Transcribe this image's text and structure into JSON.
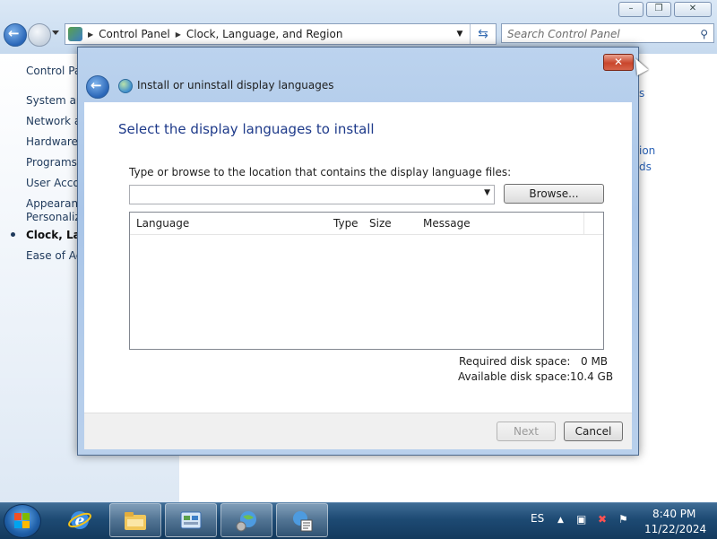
{
  "explorer": {
    "address": {
      "crumbs": [
        "Control Panel",
        "Clock, Language, and Region"
      ]
    },
    "search_placeholder": "Search Control Panel",
    "window_buttons": {
      "minimize": "–",
      "maximize": "❐",
      "close": "✕"
    },
    "sidebar": {
      "items": [
        {
          "label": "Control Pa"
        },
        {
          "label": "System and"
        },
        {
          "label": "Network ar"
        },
        {
          "label": "Hardware a"
        },
        {
          "label": "Programs"
        },
        {
          "label": "User Accou"
        },
        {
          "label": "Appearanc"
        },
        {
          "label": "Personaliza"
        },
        {
          "label": "Clock, Lanc"
        },
        {
          "label": "Ease of Acc"
        }
      ]
    },
    "right_links": [
      "s",
      "ion",
      "ds"
    ]
  },
  "dialog": {
    "title": "Install or uninstall display languages",
    "close_glyph": "✕",
    "heading": "Select the display languages to install",
    "instruction": "Type or browse to the location that contains the display language files:",
    "path_value": "",
    "browse_label": "Browse...",
    "list_columns": [
      "Language",
      "Type",
      "Size",
      "Message"
    ],
    "required_label": "Required disk space:",
    "required_value": "0 MB",
    "available_label": "Available disk space:",
    "available_value": "10.4 GB",
    "next_label": "Next",
    "cancel_label": "Cancel"
  },
  "taskbar": {
    "language": "ES",
    "time": "8:40 PM",
    "date": "11/22/2024",
    "apps": [
      "internet-explorer",
      "windows-explorer",
      "control-panel",
      "globe-settings",
      "language-installer"
    ]
  }
}
